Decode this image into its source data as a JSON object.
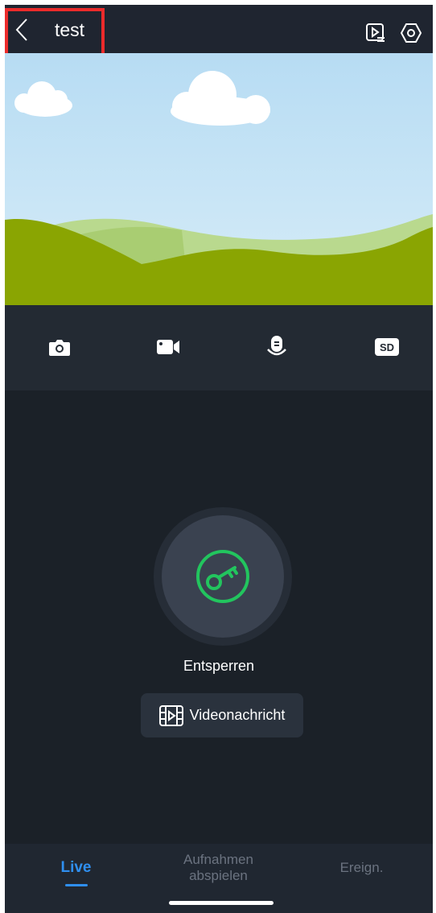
{
  "header": {
    "title": "test"
  },
  "icons": {
    "back": "chevron-left-icon",
    "playback_list": "playback-list-icon",
    "settings": "hexagon-settings-icon",
    "snapshot": "camera-icon",
    "record": "video-camera-icon",
    "talk": "microphone-icon",
    "quality": "sd-badge-icon",
    "unlock": "key-icon",
    "video_message": "film-icon"
  },
  "toolbar": {
    "quality_label": "SD"
  },
  "main": {
    "unlock_label": "Entsperren",
    "video_message_label": "Videonachricht"
  },
  "bottom_nav": {
    "tabs": [
      {
        "label": "Live"
      },
      {
        "label": "Aufnahmen\nabspielen"
      },
      {
        "label": "Ereign."
      }
    ]
  },
  "colors": {
    "accent": "#2f8ff0",
    "unlock_green": "#22c55e",
    "highlight": "#ec2b2b"
  }
}
